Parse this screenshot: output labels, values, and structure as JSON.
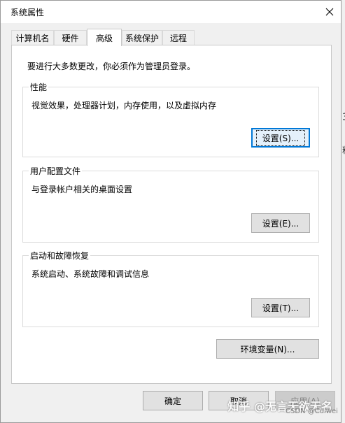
{
  "window": {
    "title": "系统属性"
  },
  "tabs": [
    {
      "label": "计算机名"
    },
    {
      "label": "硬件"
    },
    {
      "label": "高级"
    },
    {
      "label": "系统保护"
    },
    {
      "label": "远程"
    }
  ],
  "admin_note": "要进行大多数更改，你必须作为管理员登录。",
  "groups": {
    "performance": {
      "title": "性能",
      "desc": "视觉效果，处理器计划，内存使用，以及虚拟内存",
      "button": "设置(S)..."
    },
    "profile": {
      "title": "用户配置文件",
      "desc": "与登录帐户相关的桌面设置",
      "button": "设置(E)..."
    },
    "startup": {
      "title": "启动和故障恢复",
      "desc": "系统启动、系统故障和调试信息",
      "button": "设置(T)..."
    }
  },
  "env_button": "环境变量(N)...",
  "footer": {
    "ok": "确定",
    "cancel": "取消",
    "apply": "应用(A)"
  },
  "watermark": "知乎 @无言无欲无名",
  "watermark_small": "CSDN @Cuiwei",
  "right_peek": [
    "3",
    "料"
  ],
  "colors": {
    "accent": "#0078d7",
    "panel_bg": "#ffffff",
    "window_bg": "#f0f0f0"
  }
}
